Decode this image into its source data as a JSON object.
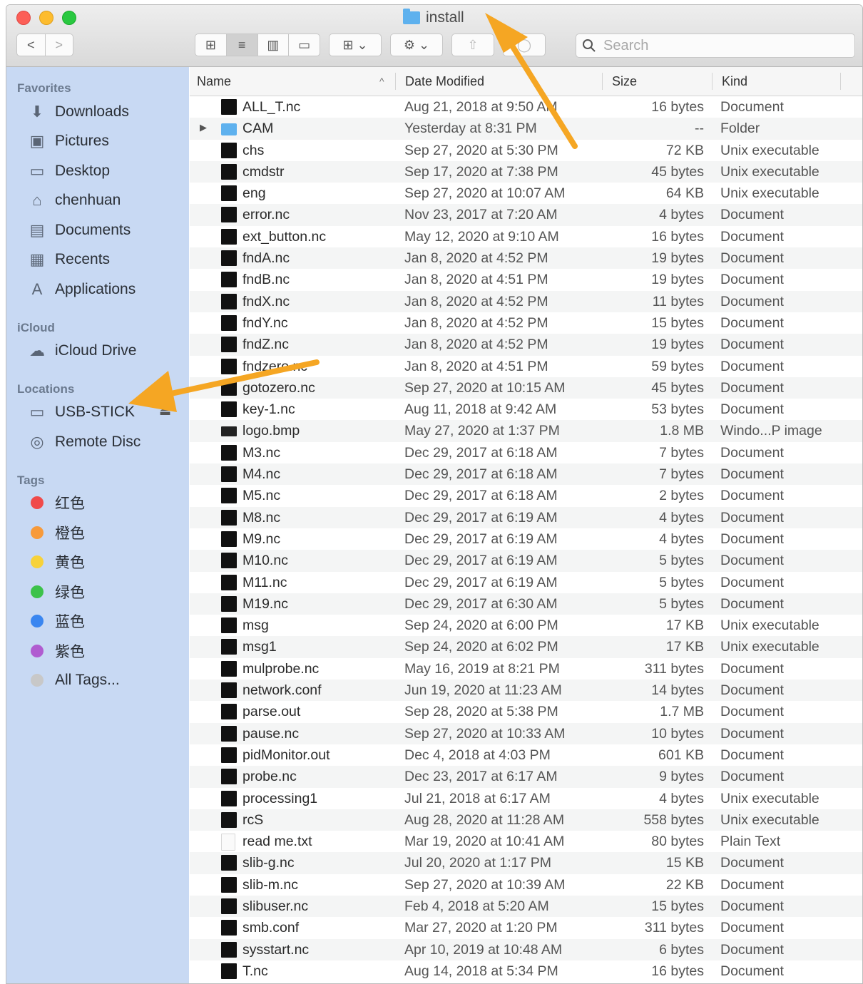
{
  "window": {
    "title": "install"
  },
  "toolbar": {
    "back_label": "<",
    "forward_label": ">",
    "view_icon_label": "⊞",
    "view_list_label": "≡",
    "view_column_label": "▥",
    "view_gallery_label": "▭",
    "group_label": "⊞ ⌄",
    "action_label": "⚙ ⌄",
    "share_label": "⇧",
    "tag_label": "◯",
    "search_placeholder": "Search"
  },
  "sidebar": {
    "favorites_title": "Favorites",
    "favorites": [
      {
        "label": "Downloads",
        "icon": "⬇"
      },
      {
        "label": "Pictures",
        "icon": "▣"
      },
      {
        "label": "Desktop",
        "icon": "▭"
      },
      {
        "label": "chenhuan",
        "icon": "⌂"
      },
      {
        "label": "Documents",
        "icon": "▤"
      },
      {
        "label": "Recents",
        "icon": "▦"
      },
      {
        "label": "Applications",
        "icon": "A"
      }
    ],
    "icloud_title": "iCloud",
    "icloud": [
      {
        "label": "iCloud Drive",
        "icon": "☁"
      }
    ],
    "locations_title": "Locations",
    "locations": [
      {
        "label": "USB-STICK",
        "icon": "▭",
        "eject": "⏏"
      },
      {
        "label": "Remote Disc",
        "icon": "◎"
      }
    ],
    "tags_title": "Tags",
    "tags": [
      {
        "label": "红色",
        "color": "#f04a4a"
      },
      {
        "label": "橙色",
        "color": "#f79a3a"
      },
      {
        "label": "黄色",
        "color": "#f7d23a"
      },
      {
        "label": "绿色",
        "color": "#3cc24a"
      },
      {
        "label": "蓝色",
        "color": "#3a86f0"
      },
      {
        "label": "紫色",
        "color": "#b05cd0"
      },
      {
        "label": "All Tags...",
        "color": "#c8c8c8"
      }
    ]
  },
  "columns": {
    "name": "Name",
    "date": "Date Modified",
    "size": "Size",
    "kind": "Kind",
    "sort_indicator": "^"
  },
  "files": [
    {
      "name": "ALL_T.nc",
      "date": "Aug 21, 2018 at 9:50 AM",
      "size": "16 bytes",
      "kind": "Document",
      "icon": "file-icon"
    },
    {
      "name": "CAM",
      "date": "Yesterday at 8:31 PM",
      "size": "--",
      "kind": "Folder",
      "icon": "folder-icon"
    },
    {
      "name": "chs",
      "date": "Sep 27, 2020 at 5:30 PM",
      "size": "72 KB",
      "kind": "Unix executable",
      "icon": "file-icon"
    },
    {
      "name": "cmdstr",
      "date": "Sep 17, 2020 at 7:38 PM",
      "size": "45 bytes",
      "kind": "Unix executable",
      "icon": "file-icon"
    },
    {
      "name": "eng",
      "date": "Sep 27, 2020 at 10:07 AM",
      "size": "64 KB",
      "kind": "Unix executable",
      "icon": "file-icon"
    },
    {
      "name": "error.nc",
      "date": "Nov 23, 2017 at 7:20 AM",
      "size": "4 bytes",
      "kind": "Document",
      "icon": "file-icon"
    },
    {
      "name": "ext_button.nc",
      "date": "May 12, 2020 at 9:10 AM",
      "size": "16 bytes",
      "kind": "Document",
      "icon": "file-icon"
    },
    {
      "name": "fndA.nc",
      "date": "Jan 8, 2020 at 4:52 PM",
      "size": "19 bytes",
      "kind": "Document",
      "icon": "file-icon"
    },
    {
      "name": "fndB.nc",
      "date": "Jan 8, 2020 at 4:51 PM",
      "size": "19 bytes",
      "kind": "Document",
      "icon": "file-icon"
    },
    {
      "name": "fndX.nc",
      "date": "Jan 8, 2020 at 4:52 PM",
      "size": "11 bytes",
      "kind": "Document",
      "icon": "file-icon"
    },
    {
      "name": "fndY.nc",
      "date": "Jan 8, 2020 at 4:52 PM",
      "size": "15 bytes",
      "kind": "Document",
      "icon": "file-icon"
    },
    {
      "name": "fndZ.nc",
      "date": "Jan 8, 2020 at 4:52 PM",
      "size": "19 bytes",
      "kind": "Document",
      "icon": "file-icon"
    },
    {
      "name": "fndzero.nc",
      "date": "Jan 8, 2020 at 4:51 PM",
      "size": "59 bytes",
      "kind": "Document",
      "icon": "file-icon"
    },
    {
      "name": "gotozero.nc",
      "date": "Sep 27, 2020 at 10:15 AM",
      "size": "45 bytes",
      "kind": "Document",
      "icon": "file-icon"
    },
    {
      "name": "key-1.nc",
      "date": "Aug 11, 2018 at 9:42 AM",
      "size": "53 bytes",
      "kind": "Document",
      "icon": "file-icon"
    },
    {
      "name": "logo.bmp",
      "date": "May 27, 2020 at 1:37 PM",
      "size": "1.8 MB",
      "kind": "Windo...P image",
      "icon": "image-icon"
    },
    {
      "name": "M3.nc",
      "date": "Dec 29, 2017 at 6:18 AM",
      "size": "7 bytes",
      "kind": "Document",
      "icon": "file-icon"
    },
    {
      "name": "M4.nc",
      "date": "Dec 29, 2017 at 6:18 AM",
      "size": "7 bytes",
      "kind": "Document",
      "icon": "file-icon"
    },
    {
      "name": "M5.nc",
      "date": "Dec 29, 2017 at 6:18 AM",
      "size": "2 bytes",
      "kind": "Document",
      "icon": "file-icon"
    },
    {
      "name": "M8.nc",
      "date": "Dec 29, 2017 at 6:19 AM",
      "size": "4 bytes",
      "kind": "Document",
      "icon": "file-icon"
    },
    {
      "name": "M9.nc",
      "date": "Dec 29, 2017 at 6:19 AM",
      "size": "4 bytes",
      "kind": "Document",
      "icon": "file-icon"
    },
    {
      "name": "M10.nc",
      "date": "Dec 29, 2017 at 6:19 AM",
      "size": "5 bytes",
      "kind": "Document",
      "icon": "file-icon"
    },
    {
      "name": "M11.nc",
      "date": "Dec 29, 2017 at 6:19 AM",
      "size": "5 bytes",
      "kind": "Document",
      "icon": "file-icon"
    },
    {
      "name": "M19.nc",
      "date": "Dec 29, 2017 at 6:30 AM",
      "size": "5 bytes",
      "kind": "Document",
      "icon": "file-icon"
    },
    {
      "name": "msg",
      "date": "Sep 24, 2020 at 6:00 PM",
      "size": "17 KB",
      "kind": "Unix executable",
      "icon": "file-icon"
    },
    {
      "name": "msg1",
      "date": "Sep 24, 2020 at 6:02 PM",
      "size": "17 KB",
      "kind": "Unix executable",
      "icon": "file-icon"
    },
    {
      "name": "mulprobe.nc",
      "date": "May 16, 2019 at 8:21 PM",
      "size": "311 bytes",
      "kind": "Document",
      "icon": "file-icon"
    },
    {
      "name": "network.conf",
      "date": "Jun 19, 2020 at 11:23 AM",
      "size": "14 bytes",
      "kind": "Document",
      "icon": "file-icon"
    },
    {
      "name": "parse.out",
      "date": "Sep 28, 2020 at 5:38 PM",
      "size": "1.7 MB",
      "kind": "Document",
      "icon": "file-icon"
    },
    {
      "name": "pause.nc",
      "date": "Sep 27, 2020 at 10:33 AM",
      "size": "10 bytes",
      "kind": "Document",
      "icon": "file-icon"
    },
    {
      "name": "pidMonitor.out",
      "date": "Dec 4, 2018 at 4:03 PM",
      "size": "601 KB",
      "kind": "Document",
      "icon": "file-icon"
    },
    {
      "name": "probe.nc",
      "date": "Dec 23, 2017 at 6:17 AM",
      "size": "9 bytes",
      "kind": "Document",
      "icon": "file-icon"
    },
    {
      "name": "processing1",
      "date": "Jul 21, 2018 at 6:17 AM",
      "size": "4 bytes",
      "kind": "Unix executable",
      "icon": "file-icon"
    },
    {
      "name": "rcS",
      "date": "Aug 28, 2020 at 11:28 AM",
      "size": "558 bytes",
      "kind": "Unix executable",
      "icon": "file-icon"
    },
    {
      "name": "read me.txt",
      "date": "Mar 19, 2020 at 10:41 AM",
      "size": "80 bytes",
      "kind": "Plain Text",
      "icon": "text-file-icon"
    },
    {
      "name": "slib-g.nc",
      "date": "Jul 20, 2020 at 1:17 PM",
      "size": "15 KB",
      "kind": "Document",
      "icon": "file-icon"
    },
    {
      "name": "slib-m.nc",
      "date": "Sep 27, 2020 at 10:39 AM",
      "size": "22 KB",
      "kind": "Document",
      "icon": "file-icon"
    },
    {
      "name": "slibuser.nc",
      "date": "Feb 4, 2018 at 5:20 AM",
      "size": "15 bytes",
      "kind": "Document",
      "icon": "file-icon"
    },
    {
      "name": "smb.conf",
      "date": "Mar 27, 2020 at 1:20 PM",
      "size": "311 bytes",
      "kind": "Document",
      "icon": "file-icon"
    },
    {
      "name": "sysstart.nc",
      "date": "Apr 10, 2019 at 10:48 AM",
      "size": "6 bytes",
      "kind": "Document",
      "icon": "file-icon"
    },
    {
      "name": "T.nc",
      "date": "Aug 14, 2018 at 5:34 PM",
      "size": "16 bytes",
      "kind": "Document",
      "icon": "file-icon"
    }
  ],
  "colors": {
    "sidebar_bg": "#c8d9f3",
    "annotation_arrow": "#f5a623",
    "folder": "#5eb1ee"
  }
}
